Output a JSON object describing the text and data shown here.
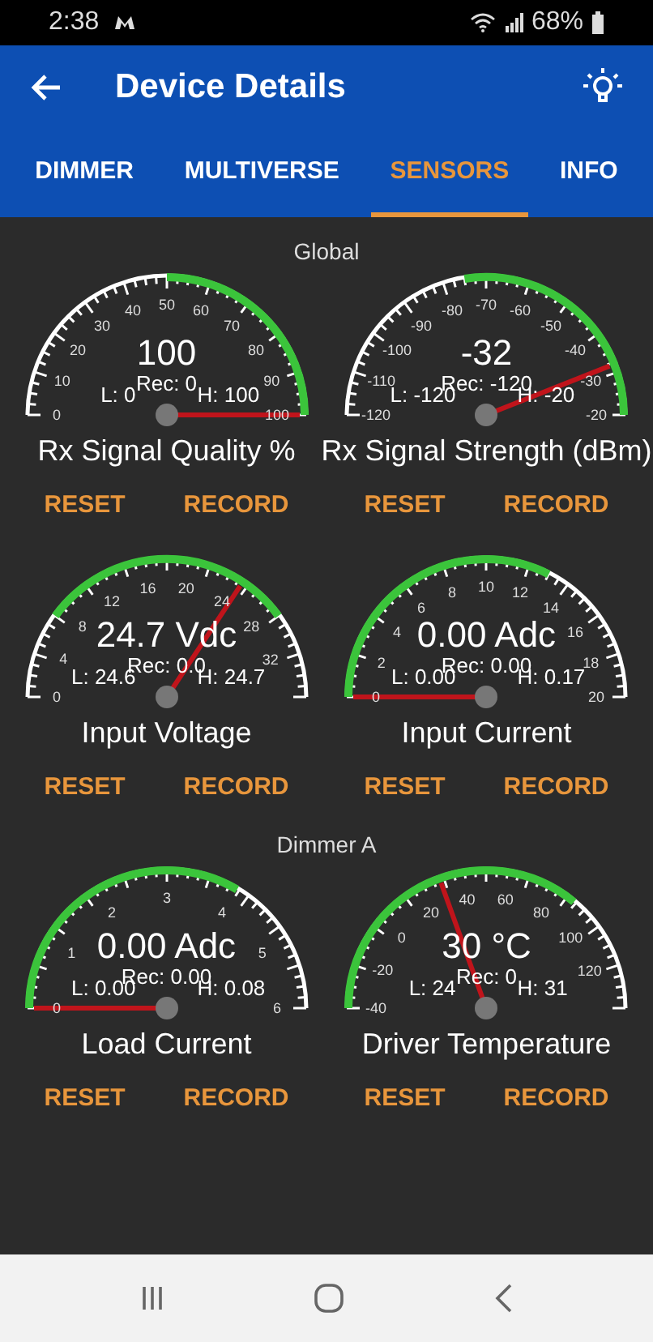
{
  "status_bar": {
    "time": "2:38",
    "battery": "68%"
  },
  "app_bar": {
    "title": "Device Details"
  },
  "tabs": [
    {
      "label": "DIMMER",
      "selected": false
    },
    {
      "label": "MULTIVERSE",
      "selected": false
    },
    {
      "label": "SENSORS",
      "selected": true
    },
    {
      "label": "INFO",
      "selected": false
    }
  ],
  "sections": [
    {
      "title": "Global",
      "gauges": [
        {
          "value": "100",
          "rec": "Rec: 0",
          "low": "L: 0",
          "high": "H: 100",
          "title": "Rx Signal Quality %",
          "ticks": [
            "0",
            "10",
            "20",
            "30",
            "40",
            "50",
            "60",
            "70",
            "80",
            "90",
            "100"
          ],
          "buttons": [
            "RESET",
            "RECORD"
          ]
        },
        {
          "value": "-32",
          "rec": "Rec: -120",
          "low": "L: -120",
          "high": "H: -20",
          "title": "Rx Signal Strength (dBm)",
          "ticks": [
            "-120",
            "-110",
            "-100",
            "-90",
            "-80",
            "-70",
            "-60",
            "-50",
            "-40",
            "-30",
            "-20"
          ],
          "buttons": [
            "RESET",
            "RECORD"
          ]
        }
      ]
    },
    {
      "gauges": [
        {
          "value": "24.7 Vdc",
          "rec": "Rec: 0.0",
          "low": "L: 24.6",
          "high": "H: 24.7",
          "title": "Input Voltage",
          "ticks": [
            "0",
            "4",
            "8",
            "12",
            "16",
            "20",
            "24",
            "28",
            "32"
          ],
          "buttons": [
            "RESET",
            "RECORD"
          ]
        },
        {
          "value": "0.00 Adc",
          "rec": "Rec: 0.00",
          "low": "L: 0.00",
          "high": "H: 0.17",
          "title": "Input Current",
          "ticks": [
            "0",
            "2",
            "4",
            "6",
            "8",
            "10",
            "12",
            "14",
            "16",
            "18",
            "20"
          ],
          "buttons": [
            "RESET",
            "RECORD"
          ]
        }
      ]
    },
    {
      "title": "Dimmer A",
      "gauges": [
        {
          "value": "0.00 Adc",
          "rec": "Rec: 0.00",
          "low": "L: 0.00",
          "high": "H: 0.08",
          "title": "Load Current",
          "ticks": [
            "0",
            "1",
            "2",
            "3",
            "4",
            "5",
            "6"
          ],
          "buttons": [
            "RESET",
            "RECORD"
          ]
        },
        {
          "value": "30 °C",
          "rec": "Rec: 0",
          "low": "L: 24",
          "high": "H: 31",
          "title": "Driver Temperature",
          "ticks": [
            "-40",
            "-20",
            "0",
            "20",
            "40",
            "60",
            "80",
            "100",
            "120"
          ],
          "buttons": [
            "RESET",
            "RECORD"
          ]
        }
      ]
    }
  ]
}
